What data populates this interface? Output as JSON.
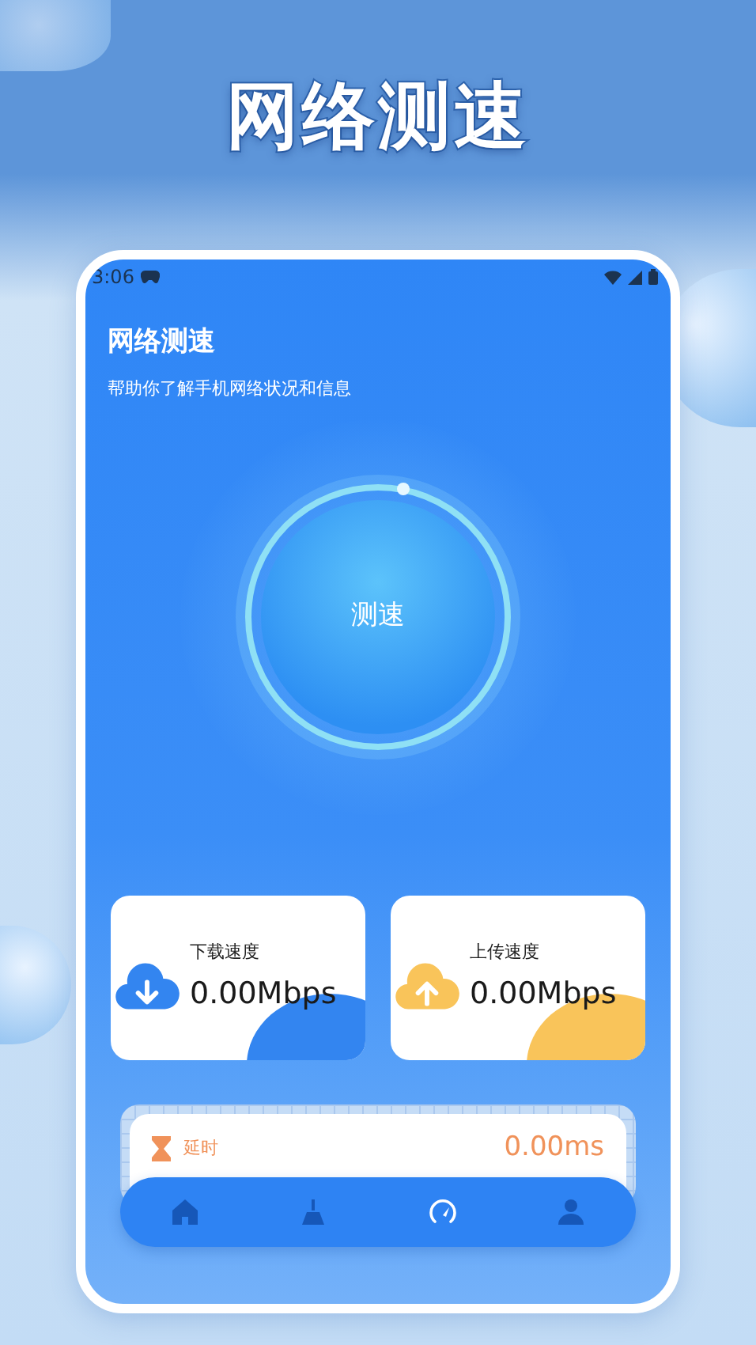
{
  "headline": "网络测速",
  "status_bar": {
    "time": "3:06"
  },
  "header": {
    "title": "网络测速",
    "subtitle": "帮助你了解手机网络状况和信息"
  },
  "test_button": {
    "label": "测速"
  },
  "speed_cards": [
    {
      "kind": "download",
      "label": "下载速度",
      "value": "0.00Mbps",
      "color": "#3385f0"
    },
    {
      "kind": "upload",
      "label": "上传速度",
      "value": "0.00Mbps",
      "color": "#f9c45a"
    }
  ],
  "latency": {
    "label": "延时",
    "value": "0.00ms"
  },
  "nav": [
    {
      "kind": "home",
      "selected": false
    },
    {
      "kind": "clean",
      "selected": false
    },
    {
      "kind": "speed",
      "selected": true
    },
    {
      "kind": "profile",
      "selected": false
    }
  ]
}
